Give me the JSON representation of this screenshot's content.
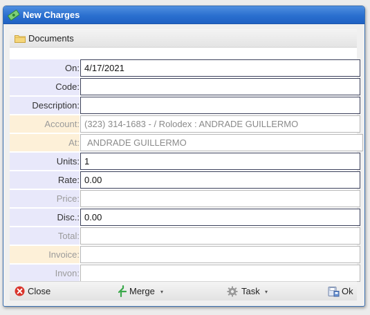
{
  "window": {
    "title": "New Charges"
  },
  "documents": {
    "label": "Documents"
  },
  "form": {
    "fields": [
      {
        "label": "On:",
        "value": "4/17/2021"
      },
      {
        "label": "Code:",
        "value": ""
      },
      {
        "label": "Description:",
        "value": ""
      },
      {
        "label": "Account:",
        "value": "(323) 314-1683 -  / Rolodex :  ANDRADE GUILLERMO"
      },
      {
        "label": "At:",
        "value": "ANDRADE GUILLERMO"
      },
      {
        "label": "Units:",
        "value": "1"
      },
      {
        "label": "Rate:",
        "value": "0.00"
      },
      {
        "label": "Price:",
        "value": ""
      },
      {
        "label": "Disc.:",
        "value": "0.00"
      },
      {
        "label": "Total:",
        "value": ""
      },
      {
        "label": "Invoice:",
        "value": ""
      },
      {
        "label": "Invon:",
        "value": ""
      }
    ]
  },
  "footer": {
    "close_label": "Close",
    "merge_label": "Merge",
    "task_label": "Task",
    "ok_label": "Ok",
    "dropdown_glyph": "▾"
  },
  "icons": {
    "title": "money-icon",
    "documents": "folder-icon",
    "close": "close-icon",
    "merge": "merge-icon",
    "task": "gear-icon",
    "ok": "save-icon"
  },
  "colors": {
    "titlebar": "#2a6fcf",
    "label_bg": "#e8e8fa",
    "account_label_bg": "#fdf0d8",
    "close_icon": "#d9342b",
    "merge_icon": "#3aa84a"
  }
}
